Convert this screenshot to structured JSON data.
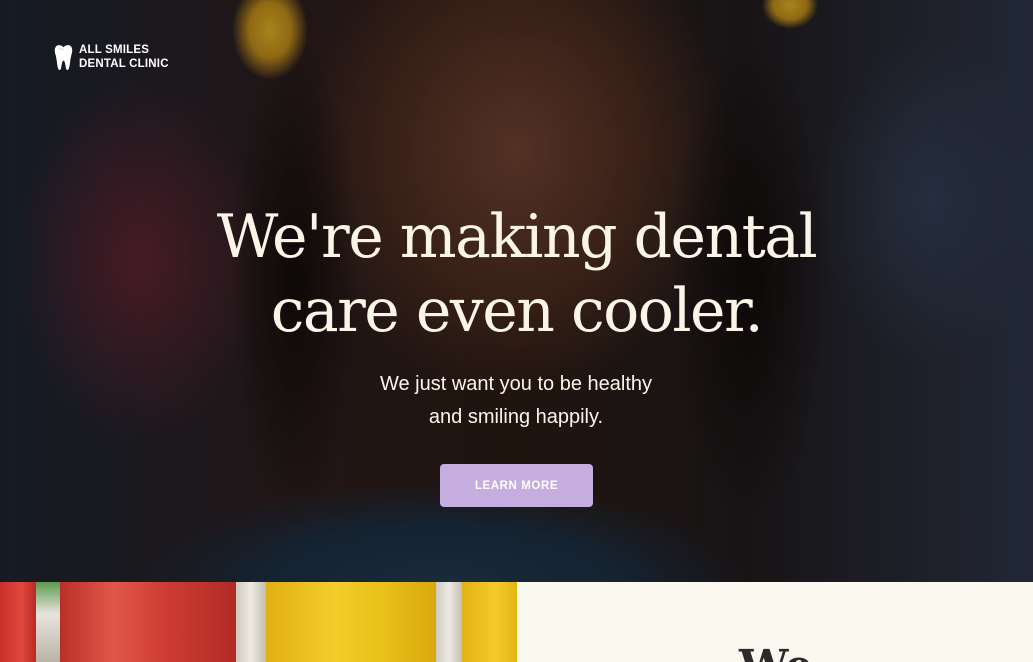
{
  "brand": {
    "icon": "tooth-icon",
    "line1": "ALL SMILES",
    "line2": "DENTAL CLINIC"
  },
  "hero": {
    "headline_line1": "We're making dental",
    "headline_line2": "care even cooler.",
    "subhead_line1": "We just want you to be healthy",
    "subhead_line2": "and smiling happily.",
    "cta_label": "LEARN MORE"
  },
  "welcome": {
    "title": "We"
  },
  "colors": {
    "headline_text": "#fbf5e8",
    "cta_bg": "#c5ade0",
    "cta_text": "#ffffff",
    "panel_bg": "#fbf9ef"
  }
}
